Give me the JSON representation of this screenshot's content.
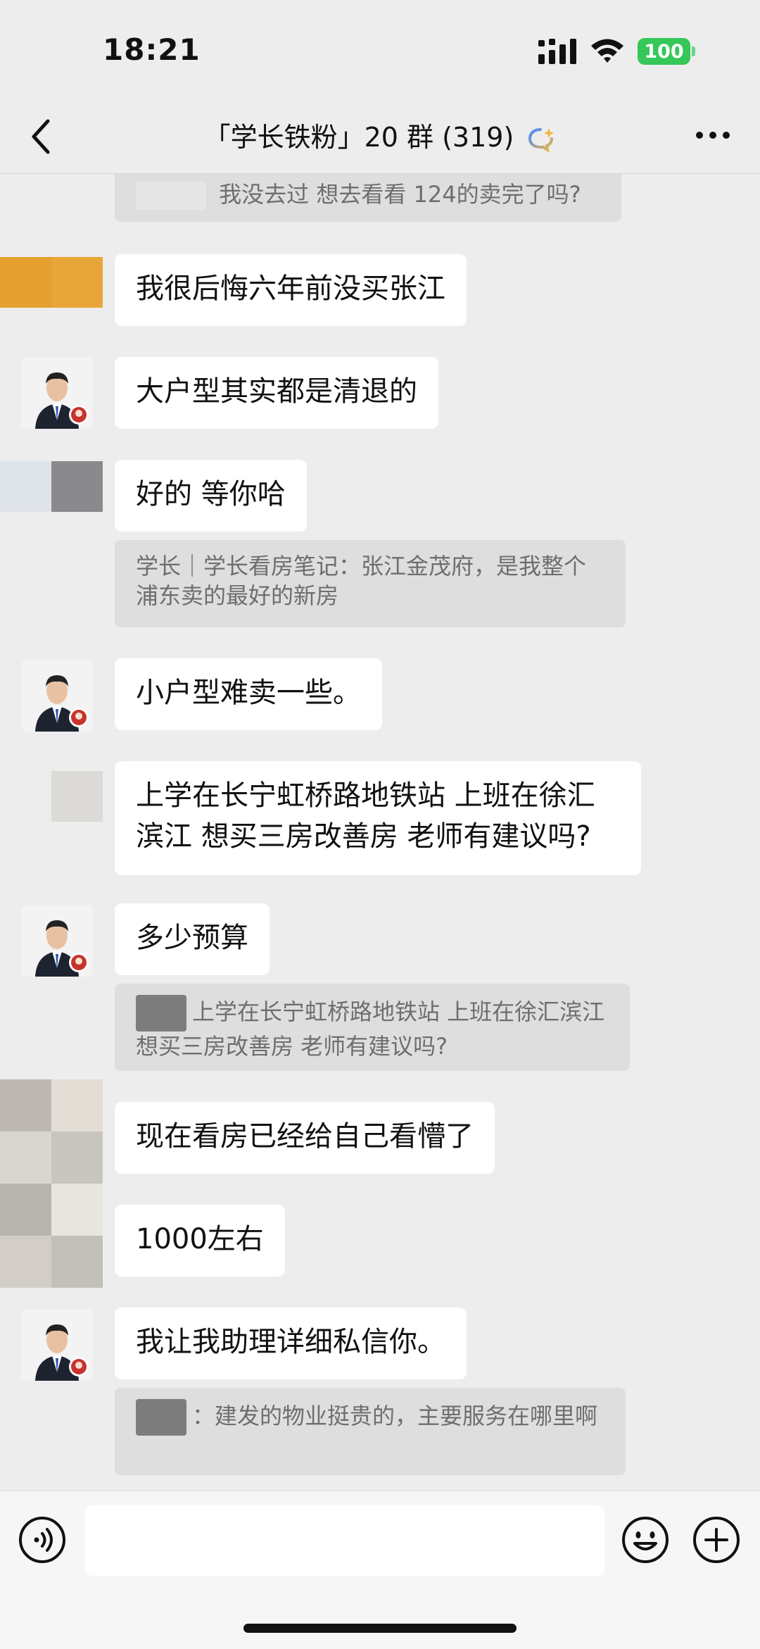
{
  "status_bar": {
    "time": "18:21",
    "battery": "100",
    "icons": [
      "signal-icon",
      "wifi-icon",
      "battery-icon"
    ]
  },
  "nav": {
    "back_icon": "chevron-left-icon",
    "title": "「学长铁粉」20 群 (319)",
    "ai_icon": "chat-bubble-ai-icon",
    "more_icon": "more-dots-icon"
  },
  "messages": {
    "q0": "我没去过 想去看看 124的卖完了吗?",
    "m1": "我很后悔六年前没买张江",
    "m2": "大户型其实都是清退的",
    "m3": "好的 等你哈",
    "q3": "学长｜学长看房笔记：张江金茂府，是我整个浦东卖的最好的新房",
    "m4": "小户型难卖一些。",
    "m5": "上学在长宁虹桥路地铁站 上班在徐汇滨江 想买三房改善房 老师有建议吗?",
    "m6": "多少预算",
    "q6": "上学在长宁虹桥路地铁站 上班在徐汇滨江 想买三房改善房 老师有建议吗?",
    "m7": "现在看房已经给自己看懵了",
    "m8": "1000左右",
    "m9": "我让我助理详细私信你。",
    "q9": "：建发的物业挺贵的，主要服务在哪里啊"
  },
  "input_bar": {
    "voice_icon": "voice-icon",
    "emoji_icon": "emoji-icon",
    "plus_icon": "plus-icon"
  },
  "colors": {
    "background": "#ededed",
    "bubble": "#ffffff",
    "quote": "#dedede",
    "battery": "#35c759"
  }
}
